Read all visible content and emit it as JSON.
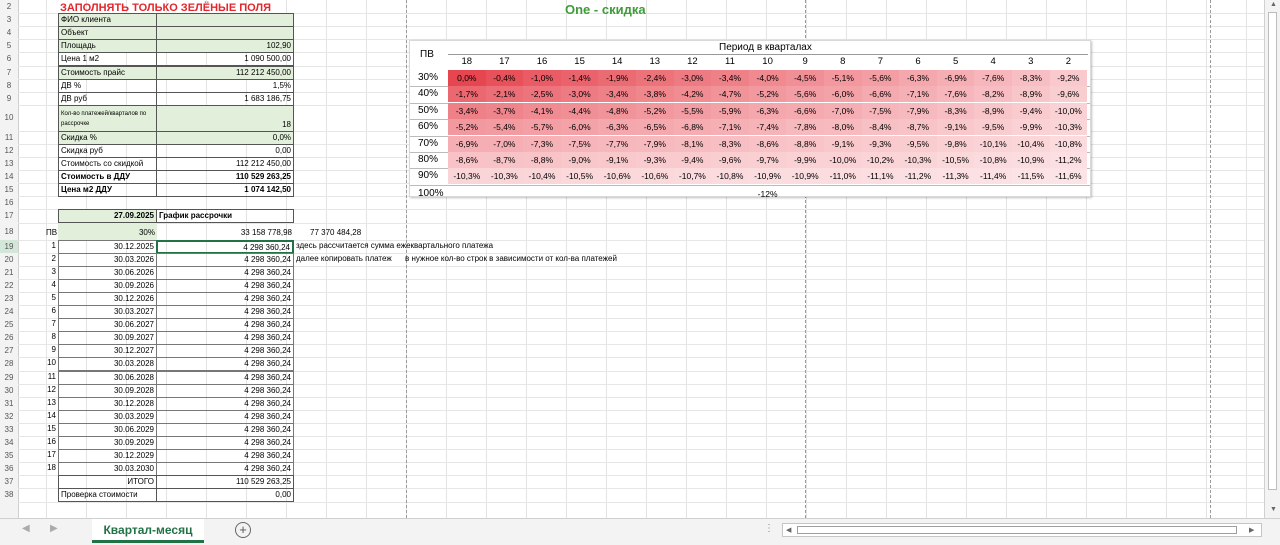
{
  "header": {
    "warning": "ЗАПОЛНЯТЬ ТОЛЬКО ЗЕЛЁНЫЕ ПОЛЯ",
    "chart_title": "One - скидка"
  },
  "row_numbers": [
    "2",
    "3",
    "4",
    "5",
    "6",
    "7",
    "8",
    "9",
    "10",
    "11",
    "12",
    "13",
    "14",
    "15",
    "16",
    "17",
    "18",
    "19",
    "20",
    "21",
    "22",
    "23",
    "24",
    "25",
    "26",
    "27",
    "28",
    "29",
    "30",
    "31",
    "32",
    "33",
    "34",
    "35",
    "36",
    "37",
    "38"
  ],
  "params": [
    {
      "label": "ФИО клиента",
      "value": "",
      "green": true,
      "bold": false
    },
    {
      "label": "Объект",
      "value": "",
      "green": true,
      "bold": false
    },
    {
      "label": "Площадь",
      "value": "102,90",
      "green": true,
      "bold": false
    },
    {
      "label": "Цена 1 м2",
      "value": "1 090 500,00",
      "green": false,
      "bold": false
    },
    {
      "label": "Стоимость прайс",
      "value": "112 212 450,00",
      "green": true,
      "bold": false
    },
    {
      "label": "ДВ %",
      "value": "1,5%",
      "green": false,
      "bold": false
    },
    {
      "label": "ДВ руб",
      "value": "1 683 186,75",
      "green": false,
      "bold": false
    },
    {
      "label": "Кол-во платежей/кварталов по рассрочке",
      "value": "18",
      "green": true,
      "bold": false,
      "tall": true
    },
    {
      "label": "Скидка %",
      "value": "0,0%",
      "green": true,
      "bold": false
    },
    {
      "label": "Скидка руб",
      "value": "0,00",
      "green": false,
      "bold": false
    },
    {
      "label": "Стоимость  со скидкой",
      "value": "112 212 450,00",
      "green": false,
      "bold": false
    },
    {
      "label": "Стоимость в ДДУ",
      "value": "110 529 263,25",
      "green": false,
      "bold": true
    },
    {
      "label": "Цена м2 ДДУ",
      "value": "1 074 142,50",
      "green": false,
      "bold": true
    }
  ],
  "schedule": {
    "date": "27.09.2025",
    "title": "График рассрочки",
    "pv_label": "ПВ",
    "pv_percent": "30%",
    "pv_amount": "33 158 778,98",
    "remaining": "77 370 484,28",
    "note1": "здесь рассчитается сумма ежеквартального платежа",
    "note2a": "далее копировать платеж",
    "note2b": "в нужное кол-во строк в зависимости от кол-ва платежей",
    "payments": [
      {
        "n": "1",
        "date": "30.12.2025",
        "amount": "4 298 360,24"
      },
      {
        "n": "2",
        "date": "30.03.2026",
        "amount": "4 298 360,24"
      },
      {
        "n": "3",
        "date": "30.06.2026",
        "amount": "4 298 360,24"
      },
      {
        "n": "4",
        "date": "30.09.2026",
        "amount": "4 298 360,24"
      },
      {
        "n": "5",
        "date": "30.12.2026",
        "amount": "4 298 360,24"
      },
      {
        "n": "6",
        "date": "30.03.2027",
        "amount": "4 298 360,24"
      },
      {
        "n": "7",
        "date": "30.06.2027",
        "amount": "4 298 360,24"
      },
      {
        "n": "8",
        "date": "30.09.2027",
        "amount": "4 298 360,24"
      },
      {
        "n": "9",
        "date": "30.12.2027",
        "amount": "4 298 360,24"
      },
      {
        "n": "10",
        "date": "30.03.2028",
        "amount": "4 298 360,24"
      },
      {
        "n": "11",
        "date": "30.06.2028",
        "amount": "4 298 360,24"
      },
      {
        "n": "12",
        "date": "30.09.2028",
        "amount": "4 298 360,24"
      },
      {
        "n": "13",
        "date": "30.12.2028",
        "amount": "4 298 360,24"
      },
      {
        "n": "14",
        "date": "30.03.2029",
        "amount": "4 298 360,24"
      },
      {
        "n": "15",
        "date": "30.06.2029",
        "amount": "4 298 360,24"
      },
      {
        "n": "16",
        "date": "30.09.2029",
        "amount": "4 298 360,24"
      },
      {
        "n": "17",
        "date": "30.12.2029",
        "amount": "4 298 360,24"
      },
      {
        "n": "18",
        "date": "30.03.2030",
        "amount": "4 298 360,24"
      }
    ],
    "total_label": "ИТОГО",
    "total": "110 529 263,25",
    "check_label": "Проверка  стоимости",
    "check_value": "0,00"
  },
  "discount_table": {
    "pv_header": "ПВ",
    "period_header": "Период в кварталах",
    "periods": [
      "18",
      "17",
      "16",
      "15",
      "14",
      "13",
      "12",
      "11",
      "10",
      "9",
      "8",
      "7",
      "6",
      "5",
      "4",
      "3",
      "2"
    ],
    "rows": [
      {
        "pv": "30%",
        "values": [
          "0,0%",
          "-0,4%",
          "-1,0%",
          "-1,4%",
          "-1,9%",
          "-2,4%",
          "-3,0%",
          "-3,4%",
          "-4,0%",
          "-4,5%",
          "-5,1%",
          "-5,6%",
          "-6,3%",
          "-6,9%",
          "-7,6%",
          "-8,3%",
          "-9,2%"
        ]
      },
      {
        "pv": "40%",
        "values": [
          "-1,7%",
          "-2,1%",
          "-2,5%",
          "-3,0%",
          "-3,4%",
          "-3,8%",
          "-4,2%",
          "-4,7%",
          "-5,2%",
          "-5,6%",
          "-6,0%",
          "-6,6%",
          "-7,1%",
          "-7,6%",
          "-8,2%",
          "-8,9%",
          "-9,6%"
        ]
      },
      {
        "pv": "50%",
        "values": [
          "-3,4%",
          "-3,7%",
          "-4,1%",
          "-4,4%",
          "-4,8%",
          "-5,2%",
          "-5,5%",
          "-5,9%",
          "-6,3%",
          "-6,6%",
          "-7,0%",
          "-7,5%",
          "-7,9%",
          "-8,3%",
          "-8,9%",
          "-9,4%",
          "-10,0%"
        ]
      },
      {
        "pv": "60%",
        "values": [
          "-5,2%",
          "-5,4%",
          "-5,7%",
          "-6,0%",
          "-6,3%",
          "-6,5%",
          "-6,8%",
          "-7,1%",
          "-7,4%",
          "-7,8%",
          "-8,0%",
          "-8,4%",
          "-8,7%",
          "-9,1%",
          "-9,5%",
          "-9,9%",
          "-10,3%"
        ]
      },
      {
        "pv": "70%",
        "values": [
          "-6,9%",
          "-7,0%",
          "-7,3%",
          "-7,5%",
          "-7,7%",
          "-7,9%",
          "-8,1%",
          "-8,3%",
          "-8,6%",
          "-8,8%",
          "-9,1%",
          "-9,3%",
          "-9,5%",
          "-9,8%",
          "-10,1%",
          "-10,4%",
          "-10,8%"
        ]
      },
      {
        "pv": "80%",
        "values": [
          "-8,6%",
          "-8,7%",
          "-8,8%",
          "-9,0%",
          "-9,1%",
          "-9,3%",
          "-9,4%",
          "-9,6%",
          "-9,7%",
          "-9,9%",
          "-10,0%",
          "-10,2%",
          "-10,3%",
          "-10,5%",
          "-10,8%",
          "-10,9%",
          "-11,2%"
        ]
      },
      {
        "pv": "90%",
        "values": [
          "-10,3%",
          "-10,3%",
          "-10,4%",
          "-10,5%",
          "-10,6%",
          "-10,6%",
          "-10,7%",
          "-10,8%",
          "-10,9%",
          "-10,9%",
          "-11,0%",
          "-11,1%",
          "-11,2%",
          "-11,3%",
          "-11,4%",
          "-11,5%",
          "-11,6%"
        ]
      }
    ],
    "full_pv": "100%",
    "full_value": "-12%"
  },
  "tabs": {
    "active": "Квартал-месяц",
    "add_icon": "plus-circle-icon"
  },
  "colors": {
    "green_fill": "#e2efda",
    "warning_red": "#e3262b",
    "title_green": "#3f9b3a",
    "tab_green": "#217346"
  }
}
